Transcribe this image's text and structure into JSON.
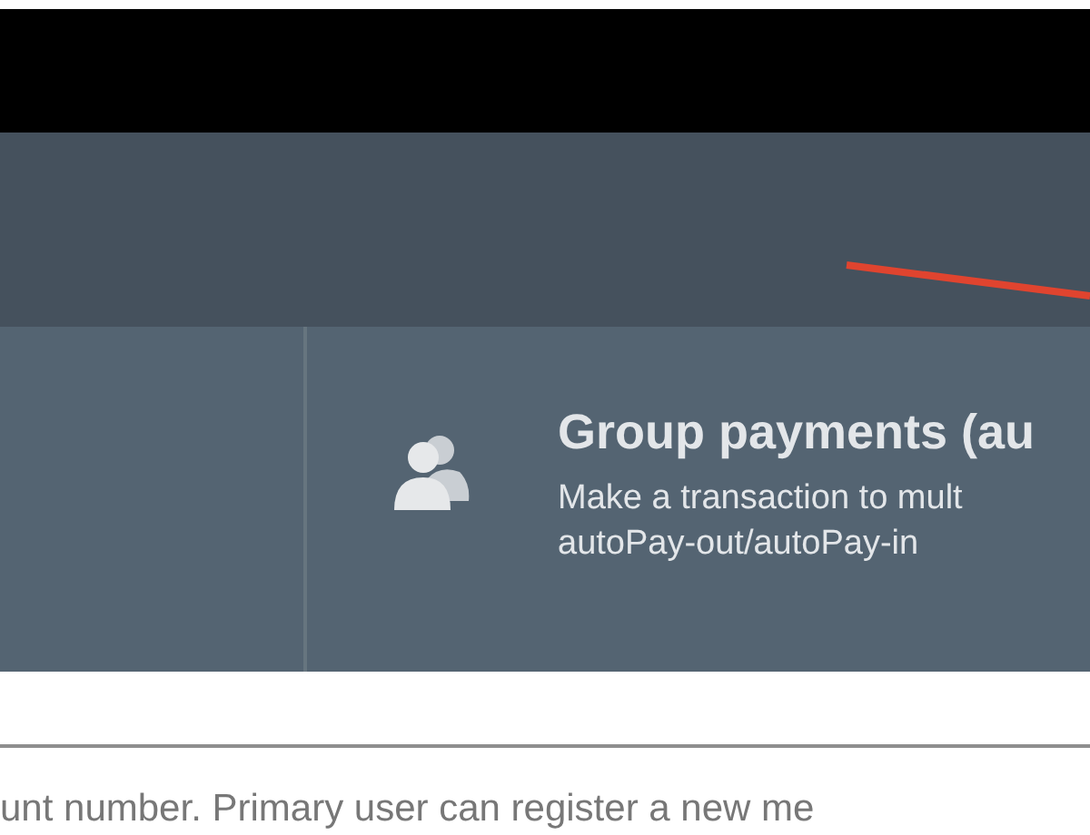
{
  "feature_card": {
    "title": "Group payments (au",
    "description": "Make a transaction to mult",
    "description_line_2": "autoPay-out/autoPay-in"
  },
  "body_text": "unt number. Primary user can register a new me"
}
